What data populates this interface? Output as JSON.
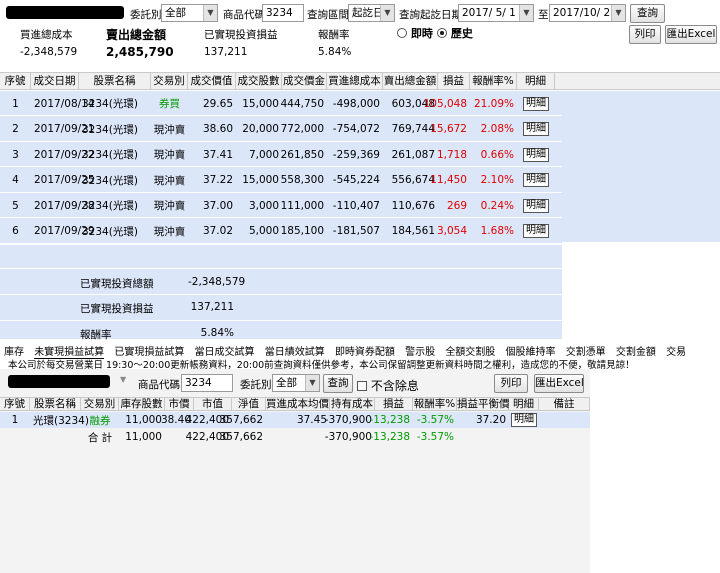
{
  "top": {
    "delegate_label": "委託別:",
    "delegate_value": "全部",
    "product_code_label": "商品代碼:",
    "product_code_value": "3234",
    "query_range_label": "查詢區間:",
    "query_range_value": "起訖日",
    "query_date_label": "查詢起訖日期:",
    "date_from": "2017/ 5/ 1",
    "to_label": "至",
    "date_to": "2017/10/ 2",
    "query_button": "查詢",
    "print_button": "列印",
    "export_button": "匯出Excel"
  },
  "summary": {
    "buy_cost_label": "買進總成本",
    "buy_cost_value": "-2,348,579",
    "sell_amount_label": "賣出總金額",
    "sell_amount_value": "2,485,790",
    "realized_pl_label": "已實現投資損益",
    "realized_pl_value": "137,211",
    "return_label": "報酬率",
    "return_value": "5.84%",
    "mode_realtime": "即時",
    "mode_history": "歷史"
  },
  "realized": {
    "headers": [
      "序號",
      "成交日期",
      "股票名稱",
      "交易別",
      "成交價值",
      "成交股數",
      "成交價金",
      "買進總成本",
      "賣出總金額",
      "損益",
      "報酬率%",
      "明細"
    ],
    "rows": [
      {
        "no": "1",
        "date": "2017/08/14",
        "name": "3234(光環)",
        "type": "券買",
        "price": "29.65",
        "shares": "15,000",
        "amount": "444,750",
        "cost": "-498,000",
        "sell": "603,048",
        "pl": "105,048",
        "ret": "21.09%",
        "detail": "明細"
      },
      {
        "no": "2",
        "date": "2017/09/21",
        "name": "3234(光環)",
        "type": "現沖賣",
        "price": "38.60",
        "shares": "20,000",
        "amount": "772,000",
        "cost": "-754,072",
        "sell": "769,744",
        "pl": "15,672",
        "ret": "2.08%",
        "detail": "明細"
      },
      {
        "no": "3",
        "date": "2017/09/22",
        "name": "3234(光環)",
        "type": "現沖賣",
        "price": "37.41",
        "shares": "7,000",
        "amount": "261,850",
        "cost": "-259,369",
        "sell": "261,087",
        "pl": "1,718",
        "ret": "0.66%",
        "detail": "明細"
      },
      {
        "no": "4",
        "date": "2017/09/25",
        "name": "3234(光環)",
        "type": "現沖賣",
        "price": "37.22",
        "shares": "15,000",
        "amount": "558,300",
        "cost": "-545,224",
        "sell": "556,674",
        "pl": "11,450",
        "ret": "2.10%",
        "detail": "明細"
      },
      {
        "no": "5",
        "date": "2017/09/28",
        "name": "3234(光環)",
        "type": "現沖賣",
        "price": "37.00",
        "shares": "3,000",
        "amount": "111,000",
        "cost": "-110,407",
        "sell": "110,676",
        "pl": "269",
        "ret": "0.24%",
        "detail": "明細"
      },
      {
        "no": "6",
        "date": "2017/09/29",
        "name": "3234(光環)",
        "type": "現沖賣",
        "price": "37.02",
        "shares": "5,000",
        "amount": "185,100",
        "cost": "-181,507",
        "sell": "184,561",
        "pl": "3,054",
        "ret": "1.68%",
        "detail": "明細"
      }
    ],
    "footer": {
      "total_invest_label": "已實現投資總額",
      "total_invest_value": "-2,348,579",
      "total_pl_label": "已實現投資損益",
      "total_pl_value": "137,211",
      "return_label": "報酬率",
      "return_value": "5.84%"
    }
  },
  "tabs": [
    "庫存",
    "未實現損益試算",
    "已實現損益試算",
    "當日成交試算",
    "當日績效試算",
    "即時資券配額",
    "警示股",
    "全額交割股",
    "個股維持率",
    "交割憑單",
    "交割金額",
    "交易"
  ],
  "active_tab": 1,
  "notice": "本公司於每交易營業日 19:30～20:00更新帳務資料，20:00前查詢資料僅供參考，本公司保留調整更新資料時間之權利，造成您的不便，敬請見諒！",
  "bottom": {
    "product_code_label": "商品代碼:",
    "product_code_value": "3234",
    "delegate_label": "委託別:",
    "delegate_value": "全部",
    "query_button": "查詢",
    "exclude_label": "不含除息",
    "print_button": "列印",
    "export_button": "匯出Excel"
  },
  "unrealized": {
    "headers": [
      "序號",
      "股票名稱",
      "交易別",
      "庫存股數",
      "市價",
      "市值",
      "淨值",
      "買進成本均價",
      "持有成本",
      "損益",
      "報酬率%",
      "損益平衡價",
      "明細",
      "備註"
    ],
    "row": {
      "no": "1",
      "name": "光環(3234)",
      "type": "融券",
      "shares": "11,000",
      "market_price": "38.40",
      "market_value": "422,400",
      "net_value": "357,662",
      "avg_cost": "37.45",
      "hold_cost": "-370,900",
      "pl": "-13,238",
      "ret": "-3.57%",
      "breakeven": "37.20",
      "detail": "明細",
      "note": ""
    },
    "total": {
      "label": "合 計",
      "shares": "11,000",
      "market_value": "422,400",
      "net_value": "357,662",
      "hold_cost": "-370,900",
      "pl": "-13,238",
      "ret": "-3.57%"
    }
  },
  "colors": {
    "row_bg": "#dce6f9",
    "profit_red": "#e00000",
    "loss_green": "#009a00"
  }
}
